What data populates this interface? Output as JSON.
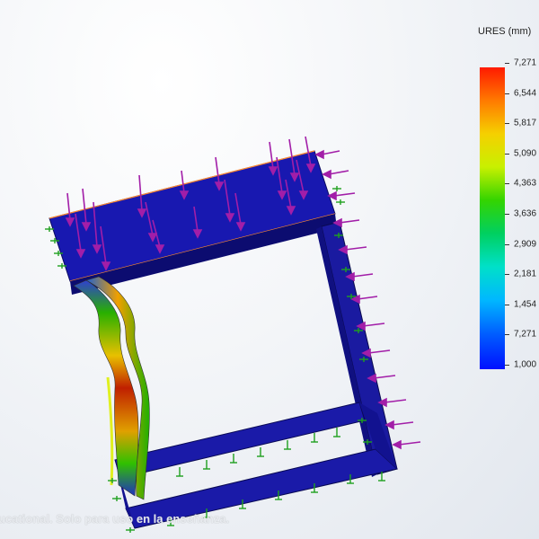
{
  "legend": {
    "title": "URES (mm)",
    "labels": [
      "7,271",
      "6,544",
      "5,817",
      "5,090",
      "4,363",
      "3,636",
      "2,909",
      "2,181",
      "1,454",
      "7,271",
      "1,000"
    ]
  },
  "watermark": "ucational. Solo para uso en la enseñanza.",
  "colors": {
    "frame_blue": "#1a1aa8",
    "load_arrow": "#a21ea8",
    "fixture_green": "#1fa01f",
    "max_red": "#ff1a00"
  },
  "icons": {
    "load": "load-arrow-icon",
    "fixture": "fixture-arrow-icon"
  }
}
